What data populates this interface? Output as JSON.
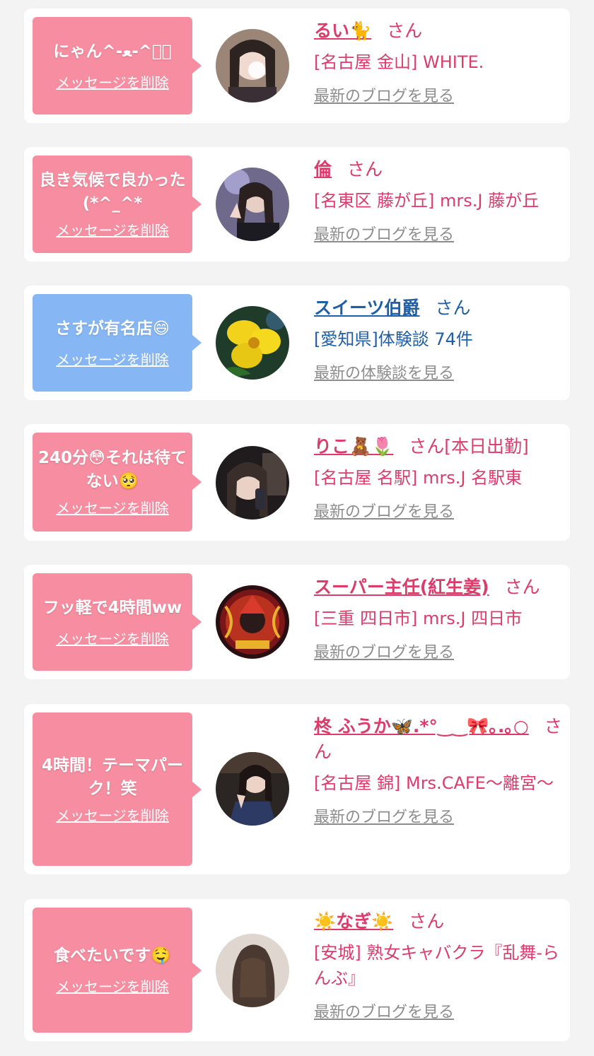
{
  "items": [
    {
      "message": "にゃん^-ﻌ-^ฅ゙",
      "delete_label": "メッセージを削除",
      "name": "るい🐈",
      "honorific": "さん",
      "shop": "[名古屋 金山] WHITE.",
      "link": "最新のブログを見る",
      "bubble_color": "#f78da0"
    },
    {
      "message": "良き気候で良かった(*^_^*",
      "delete_label": "メッセージを削除",
      "name": "倫",
      "honorific": "さん",
      "shop": "[名東区 藤が丘] mrs.J 藤が丘",
      "link": "最新のブログを見る",
      "bubble_color": "#f78da0"
    },
    {
      "message": "さすが有名店😄",
      "delete_label": "メッセージを削除",
      "name": "スイーツ伯爵",
      "honorific": "さん",
      "shop": "[愛知県]体験談 74件",
      "link": "最新の体験談を見る",
      "bubble_color": "#86b7f4"
    },
    {
      "message": "240分😳それは待てない🥺",
      "delete_label": "メッセージを削除",
      "name": "りこ🧸🌷",
      "honorific": "さん[本日出勤]",
      "shop": "[名古屋 名駅] mrs.J 名駅東",
      "link": "最新のブログを見る",
      "bubble_color": "#f78da0"
    },
    {
      "message": "フッ軽で4時間ww",
      "delete_label": "メッセージを削除",
      "name": "スーパー主任(紅生姜)",
      "honorific": "さん",
      "shop": "[三重 四日市] mrs.J 四日市",
      "link": "最新のブログを見る",
      "bubble_color": "#f78da0"
    },
    {
      "message": "4時間！テーマパーク！笑",
      "delete_label": "メッセージを削除",
      "name": "柊 ふうか🦋.*°‿‿🎀｡.｡○",
      "honorific": "さん",
      "shop": "[名古屋 錦] Mrs.CAFE〜離宮〜",
      "link": "最新のブログを見る",
      "bubble_color": "#f78da0"
    },
    {
      "message": "食べたいです🤤",
      "delete_label": "メッセージを削除",
      "name": "☀️なぎ☀️",
      "honorific": "さん",
      "shop": "[安城] 熟女キャバクラ『乱舞-らんぶ』",
      "link": "最新のブログを見る",
      "bubble_color": "#f78da0"
    }
  ],
  "colors": {
    "accent": "#dd3b6a",
    "user_link": "#1f5ea8",
    "muted_link": "#8d8d8d",
    "page_bg": "#f3f3f3"
  }
}
